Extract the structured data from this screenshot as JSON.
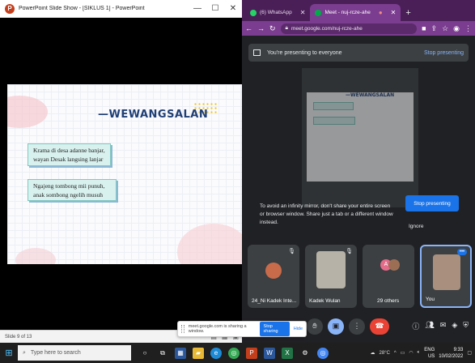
{
  "powerpoint": {
    "window_title": "PowerPoint Slide Show - [SIKLUS 1] - PowerPoint",
    "slide_heading": "—WEWANGSALAN",
    "box1_lines": [
      "Krama di desa adanne banjar,",
      "wayan Desak langsing lanjar"
    ],
    "box2_lines": [
      "Ngajeng tombong mii punuh,",
      "anak sombong ngelih musuh"
    ],
    "status_text": "Slide 9 of 13"
  },
  "chrome": {
    "tabs": [
      {
        "label": "(6) WhatsApp",
        "color": "#25d366"
      },
      {
        "label": "Meet - nuj-rcze-ahe",
        "color": "#00ac47"
      }
    ],
    "new_tab": "+",
    "url": "meet.google.com/nuj-rcze-ahe"
  },
  "meet": {
    "banner_text": "You're presenting to everyone",
    "banner_stop": "Stop presenting",
    "warning_line1": "To avoid an infinity mirror, don't share your entire screen",
    "warning_line2": "or browser window. Share just a tab or a different window",
    "warning_line3": "instead.",
    "stop_button": "Stop presenting",
    "ignore": "Ignore",
    "participants": [
      {
        "name": "24_Ni Kadek Inte..."
      },
      {
        "name": "Kadek Wulan"
      },
      {
        "name": "29 others",
        "initial": "A"
      },
      {
        "name": "You"
      }
    ]
  },
  "share_bar": {
    "text": "meet.google.com is sharing a window.",
    "stop": "Stop sharing",
    "hide": "Hide"
  },
  "taskbar": {
    "search_placeholder": "Type here to search",
    "temperature": "28°C",
    "lang": "ENG",
    "region": "US",
    "time": "9:33",
    "date": "10/02/2022"
  }
}
